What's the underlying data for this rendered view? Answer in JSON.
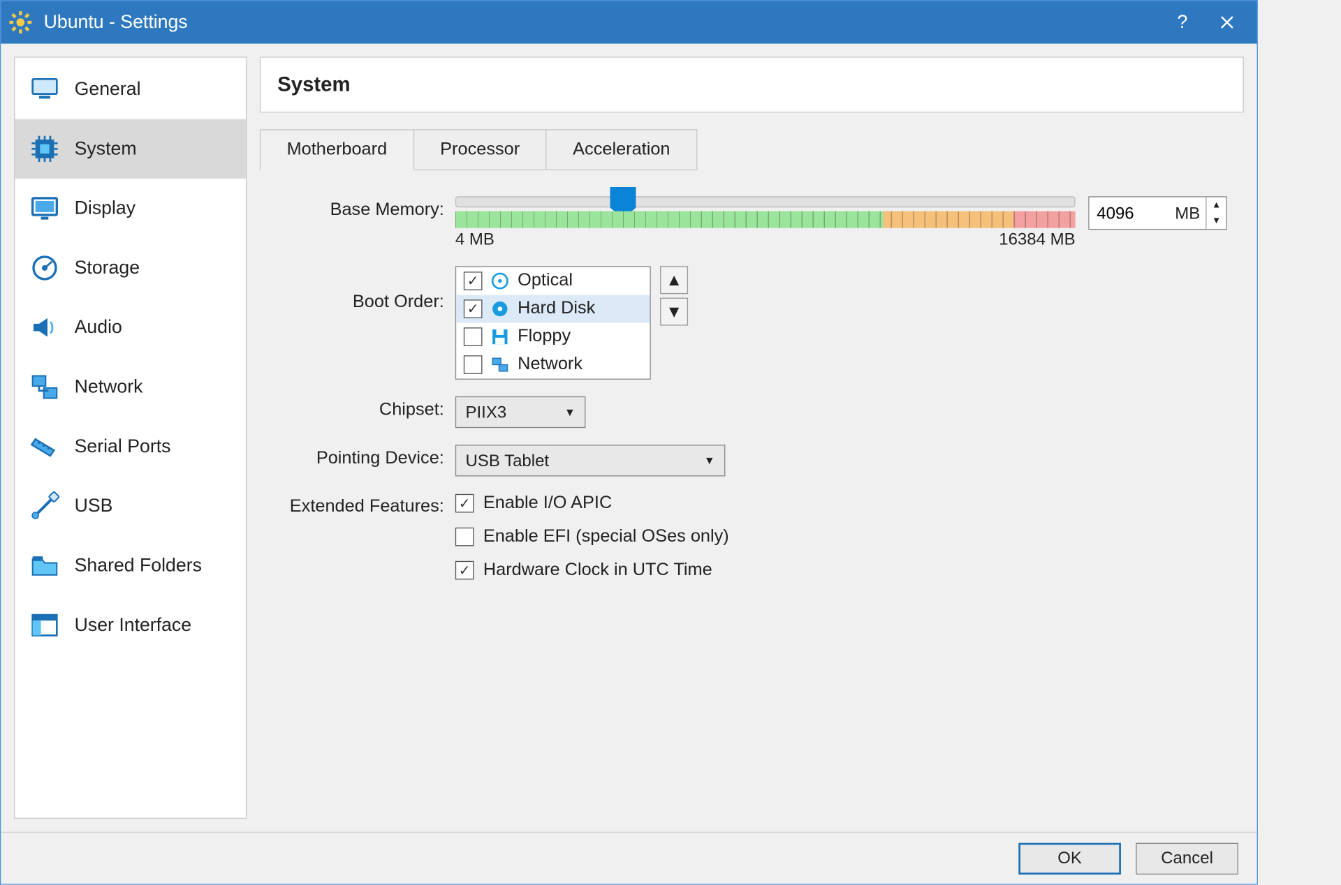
{
  "window": {
    "title": "Ubuntu - Settings"
  },
  "sidebar": {
    "items": [
      {
        "label": "General"
      },
      {
        "label": "System"
      },
      {
        "label": "Display"
      },
      {
        "label": "Storage"
      },
      {
        "label": "Audio"
      },
      {
        "label": "Network"
      },
      {
        "label": "Serial Ports"
      },
      {
        "label": "USB"
      },
      {
        "label": "Shared Folders"
      },
      {
        "label": "User Interface"
      }
    ],
    "selected_label": "System"
  },
  "header": {
    "title": "System"
  },
  "tabs": {
    "motherboard": "Motherboard",
    "processor": "Processor",
    "acceleration": "Acceleration",
    "active": "Motherboard"
  },
  "labels": {
    "base_memory": "Base Memory:",
    "boot_order": "Boot Order:",
    "chipset": "Chipset:",
    "pointing_device": "Pointing Device:",
    "extended_features": "Extended Features:"
  },
  "base_memory": {
    "value": "4096",
    "unit": "MB",
    "min_label": "4 MB",
    "max_label": "16384 MB",
    "min": 4,
    "max": 16384
  },
  "boot_order": {
    "items": [
      {
        "label": "Optical",
        "checked": true,
        "selected": false,
        "icon": "disc"
      },
      {
        "label": "Hard Disk",
        "checked": true,
        "selected": true,
        "icon": "hdd"
      },
      {
        "label": "Floppy",
        "checked": false,
        "selected": false,
        "icon": "floppy"
      },
      {
        "label": "Network",
        "checked": false,
        "selected": false,
        "icon": "net"
      }
    ]
  },
  "chipset": {
    "value": "PIIX3"
  },
  "pointing_device": {
    "value": "USB Tablet"
  },
  "extended_features": {
    "io_apic": {
      "label": "Enable I/O APIC",
      "checked": true
    },
    "efi": {
      "label": "Enable EFI (special OSes only)",
      "checked": false
    },
    "hw_clock": {
      "label": "Hardware Clock in UTC Time",
      "checked": true
    }
  },
  "footer": {
    "ok": "OK",
    "cancel": "Cancel"
  }
}
